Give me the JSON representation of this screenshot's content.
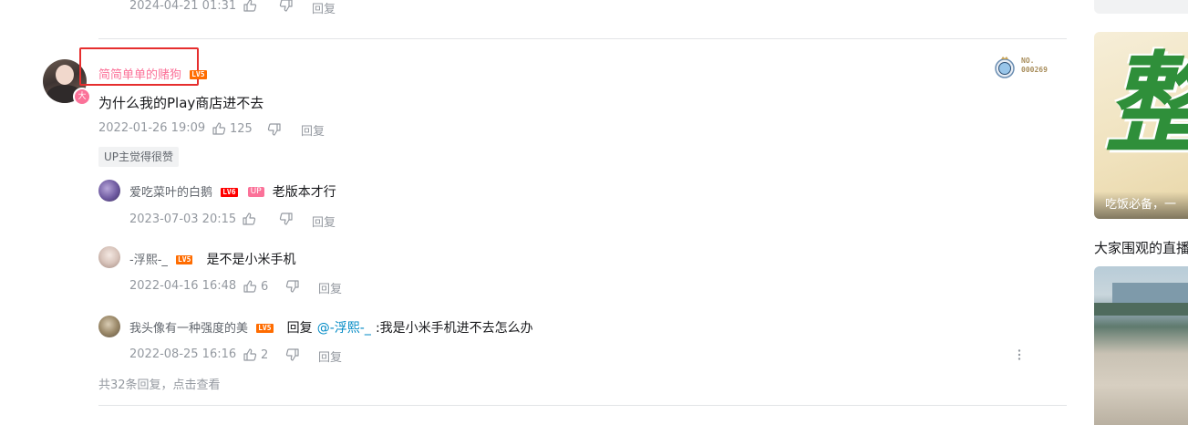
{
  "prev": {
    "time": "2024-04-21 01:31",
    "reply": "回复"
  },
  "comment": {
    "username": "简简单单的赌狗",
    "level": "LV5",
    "avatar_badge": "大",
    "text": "为什么我的Play商店进不去",
    "time": "2022-01-26 19:09",
    "likes": "125",
    "reply": "回复",
    "up_tag": "UP主觉得很赞",
    "fan_badge_label": "NO.",
    "fan_badge_number": "000269"
  },
  "replies": [
    {
      "username": "爱吃菜叶的白鹅",
      "level": "LV6",
      "up": "UP",
      "content": "老版本才行",
      "time": "2023-07-03 20:15",
      "likes": "",
      "reply": "回复"
    },
    {
      "username": "-浮熙-_",
      "level": "LV5",
      "content": "是不是小米手机",
      "time": "2022-04-16 16:48",
      "likes": "6",
      "reply": "回复"
    },
    {
      "username": "我头像有一种强度的美",
      "level": "LV5",
      "prefix": "回复",
      "mention": "@-浮熙-_",
      "content": ":我是小米手机进不去怎么办",
      "time": "2022-08-25 16:16",
      "likes": "2",
      "reply": "回复"
    }
  ],
  "more_replies": "共32条回复，点击查看",
  "sidebar": {
    "banner_big_text": "整",
    "banner_caption": "吃饭必备，一",
    "section_title": "大家围观的直播"
  },
  "colors": {
    "pink": "#fb7299",
    "level5": "#ff6c00",
    "level6": "#ff0000",
    "highlight_box": "#e62e2e",
    "link": "#008ac5"
  }
}
